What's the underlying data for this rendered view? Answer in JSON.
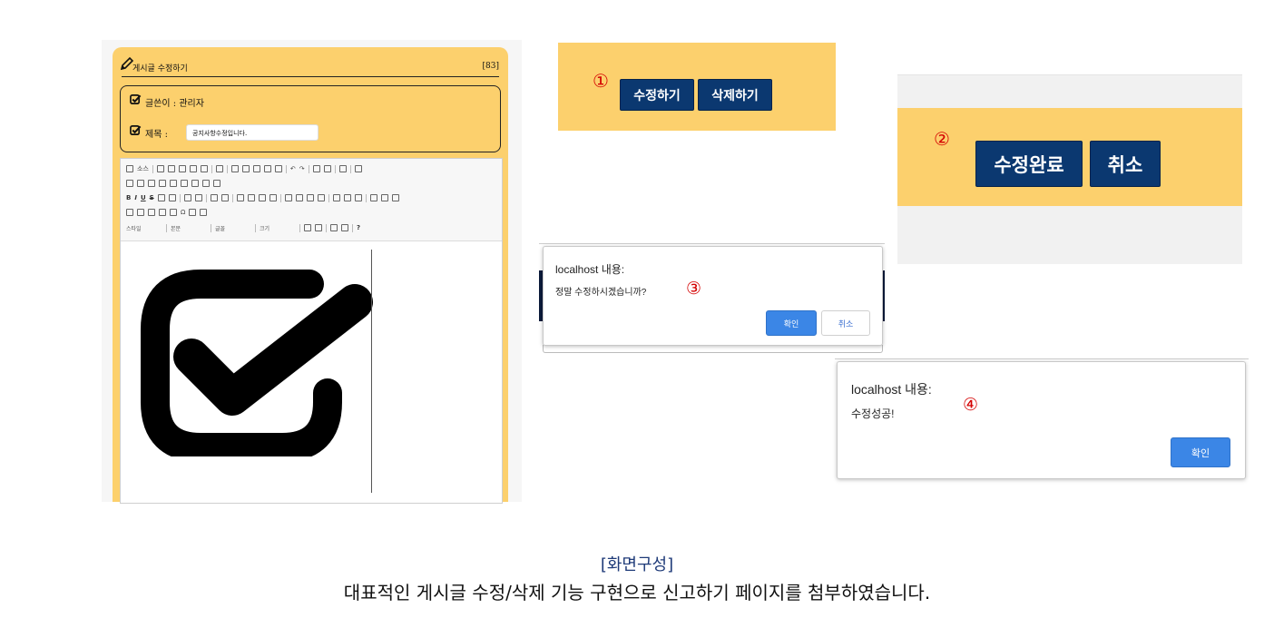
{
  "edit_page": {
    "header_title": "게시글 수정하기",
    "header_count": "[83]",
    "author_label": "글쓴이 : 관리자",
    "title_label": "제목 :",
    "title_value": "공지사항수정입니다.",
    "toolbar": {
      "source_label": "소스",
      "format_bold": "B",
      "format_italic": "I",
      "format_underline": "U",
      "format_strike": "S",
      "combo_style": "스타일",
      "combo_format": "본문",
      "combo_font": "글꼴",
      "combo_size": "크기",
      "help": "?"
    }
  },
  "step1": {
    "number": "①",
    "edit_button": "수정하기",
    "delete_button": "삭제하기"
  },
  "step2": {
    "number": "②",
    "complete_button": "수정완료",
    "cancel_button": "취소"
  },
  "step3": {
    "number": "③",
    "dialog_title": "localhost 내용:",
    "dialog_message": "정말 수정하시겠습니까?",
    "ok_button": "확인",
    "cancel_button": "취소"
  },
  "step4": {
    "number": "④",
    "dialog_title": "localhost 내용:",
    "dialog_message": "수정성공!",
    "ok_button": "확인"
  },
  "caption": {
    "title": "[화면구성]",
    "description": "대표적인 게시글 수정/삭제 기능 구현으로 신고하기 페이지를 첨부하였습니다."
  },
  "colors": {
    "panel_yellow": "#fcd06d",
    "navy_button": "#0b3870",
    "dialog_blue": "#3b86e6",
    "step_red": "#d40000",
    "caption_blue": "#1e3a78"
  },
  "icons": [
    "pencil-icon",
    "checkbox-check-icon",
    "big-checkbox-icon"
  ]
}
